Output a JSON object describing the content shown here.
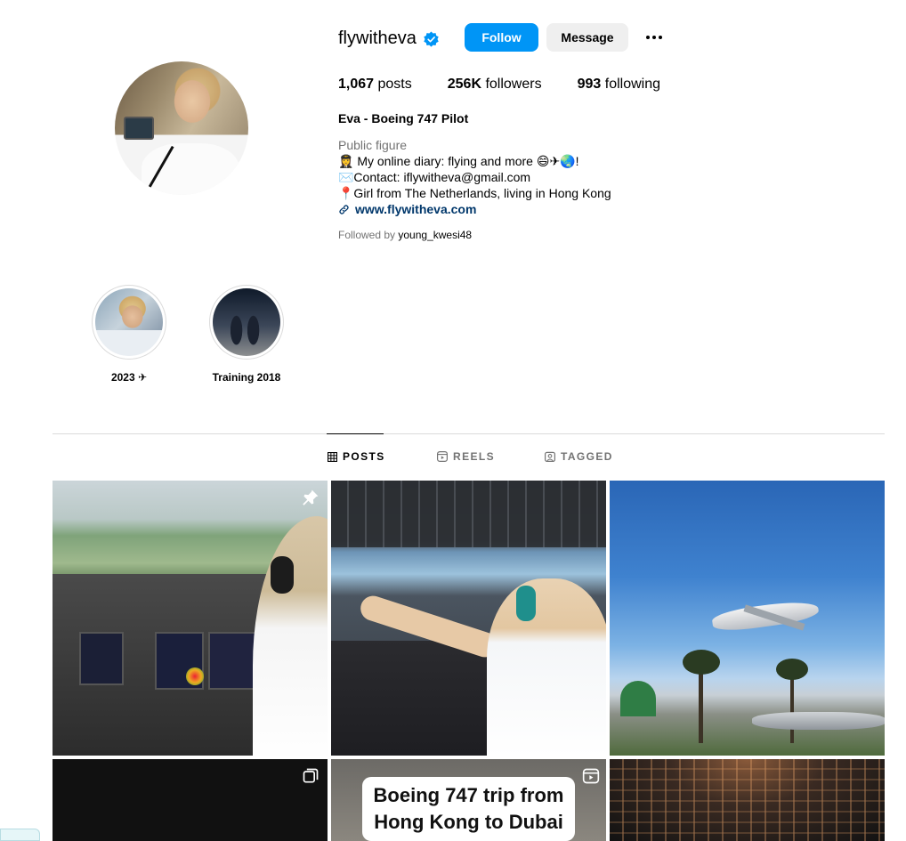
{
  "profile": {
    "username": "flywitheva",
    "follow_label": "Follow",
    "message_label": "Message",
    "posts_count": "1,067",
    "posts_label": "posts",
    "followers_count": "256K",
    "followers_label": "followers",
    "following_count": "993",
    "following_label": "following",
    "full_name": "Eva - Boeing 747 Pilot",
    "category": "Public figure",
    "bio": [
      "👩‍✈️ My online diary: flying and more 😄✈🌏!",
      "✉️Contact: iflywitheva@gmail.com",
      "📍Girl from The Netherlands, living in Hong Kong"
    ],
    "website": "www.flywitheva.com",
    "followed_by_prefix": "Followed by ",
    "followed_by_name": "young_kwesi48"
  },
  "highlights": [
    {
      "label": "2023 ✈"
    },
    {
      "label": "Training 2018"
    }
  ],
  "tabs": [
    {
      "label": "POSTS",
      "icon": "grid-icon",
      "active": true
    },
    {
      "label": "REELS",
      "icon": "reels-icon",
      "active": false
    },
    {
      "label": "TAGGED",
      "icon": "tagged-icon",
      "active": false
    }
  ],
  "posts": [
    {
      "subject": "cockpit-view-runway",
      "badge": "pin-icon"
    },
    {
      "subject": "pilot-at-controls",
      "badge": ""
    },
    {
      "subject": "boeing-747-landing-palms",
      "badge": ""
    },
    {
      "subject": "dark-post",
      "badge": "carousel-icon"
    },
    {
      "subject": "reel-title",
      "badge": "reel-icon",
      "text": "Boeing 747 trip from Hong Kong to Dubai"
    },
    {
      "subject": "cockpit-night",
      "badge": ""
    }
  ],
  "colors": {
    "accent": "#0095f6",
    "secondary_button": "#efefef",
    "link": "#00376b",
    "muted_text": "#737373",
    "divider": "#dbdbdb",
    "verified": "#0095f6"
  }
}
